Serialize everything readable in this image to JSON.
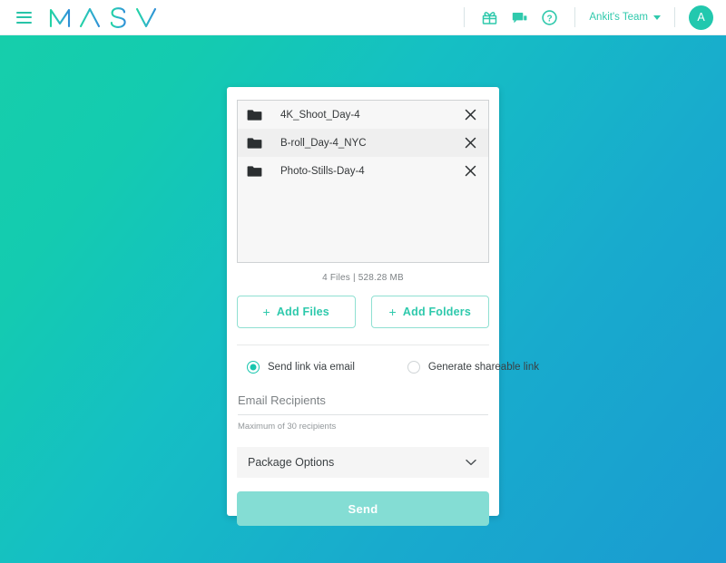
{
  "header": {
    "menu_icon": "hamburger-icon",
    "logo_text": "MASV",
    "icons": [
      {
        "name": "gift-icon",
        "label": "Rewards"
      },
      {
        "name": "chat-icon",
        "label": "Messages"
      },
      {
        "name": "help-icon",
        "label": "Help"
      }
    ],
    "team_name": "Ankit's Team",
    "avatar_initial": "A"
  },
  "card": {
    "files": [
      {
        "name": "4K_Shoot_Day-4",
        "icon": "folder-icon",
        "remove": "close-icon"
      },
      {
        "name": "B-roll_Day-4_NYC",
        "icon": "folder-icon",
        "remove": "close-icon"
      },
      {
        "name": "Photo-Stills-Day-4",
        "icon": "folder-icon",
        "remove": "close-icon"
      }
    ],
    "summary": "4 Files | 528.28 MB",
    "add_files_label": "Add Files",
    "add_folders_label": "Add Folders",
    "plus": "+",
    "delivery_options": [
      {
        "label": "Send link via email",
        "selected": true
      },
      {
        "label": "Generate shareable link",
        "selected": false
      }
    ],
    "recipients_placeholder": "Email Recipients",
    "recipients_value": "",
    "recipients_help": "Maximum of 30 recipients",
    "package_options_label": "Package Options",
    "package_chevron": "chevron-down-icon",
    "send_label": "Send"
  },
  "colors": {
    "accent": "#2ec9ac",
    "gradient_start": "#16ceab",
    "gradient_end": "#1a9bd1",
    "send_button": "#84ddd4"
  }
}
